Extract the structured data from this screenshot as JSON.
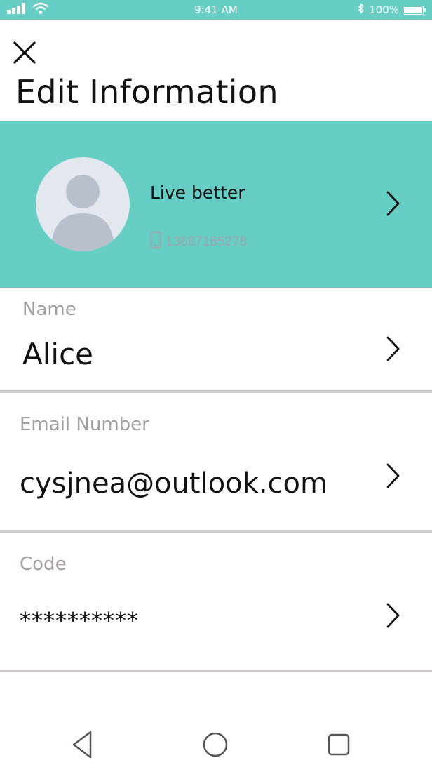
{
  "status_bar": {
    "time": "9:41 AM",
    "battery": "100%",
    "icons": [
      "signal-icon",
      "wifi-icon",
      "bluetooth-icon",
      "battery-icon"
    ]
  },
  "header": {
    "title": "Edit Information",
    "close_icon": "close-icon"
  },
  "profile": {
    "name": "Live better",
    "phone": "13687165278",
    "icons": [
      "avatar-placeholder-icon",
      "phone-icon",
      "chevron-right-icon"
    ]
  },
  "fields": {
    "name": {
      "label": "Name",
      "value": "Alice"
    },
    "email": {
      "label": "Email Number",
      "value": "cysjnea@outlook.com"
    },
    "code": {
      "label": "Code",
      "value": "**********"
    }
  },
  "nav_bar": {
    "icons": [
      "back-icon",
      "home-icon",
      "recents-icon"
    ]
  },
  "colors": {
    "accent": "#66cec5",
    "label": "#a59e9e",
    "divider": "#cfcbcb",
    "avatar_bg": "#e3e8ef",
    "avatar_figure": "#b9bfcc"
  }
}
